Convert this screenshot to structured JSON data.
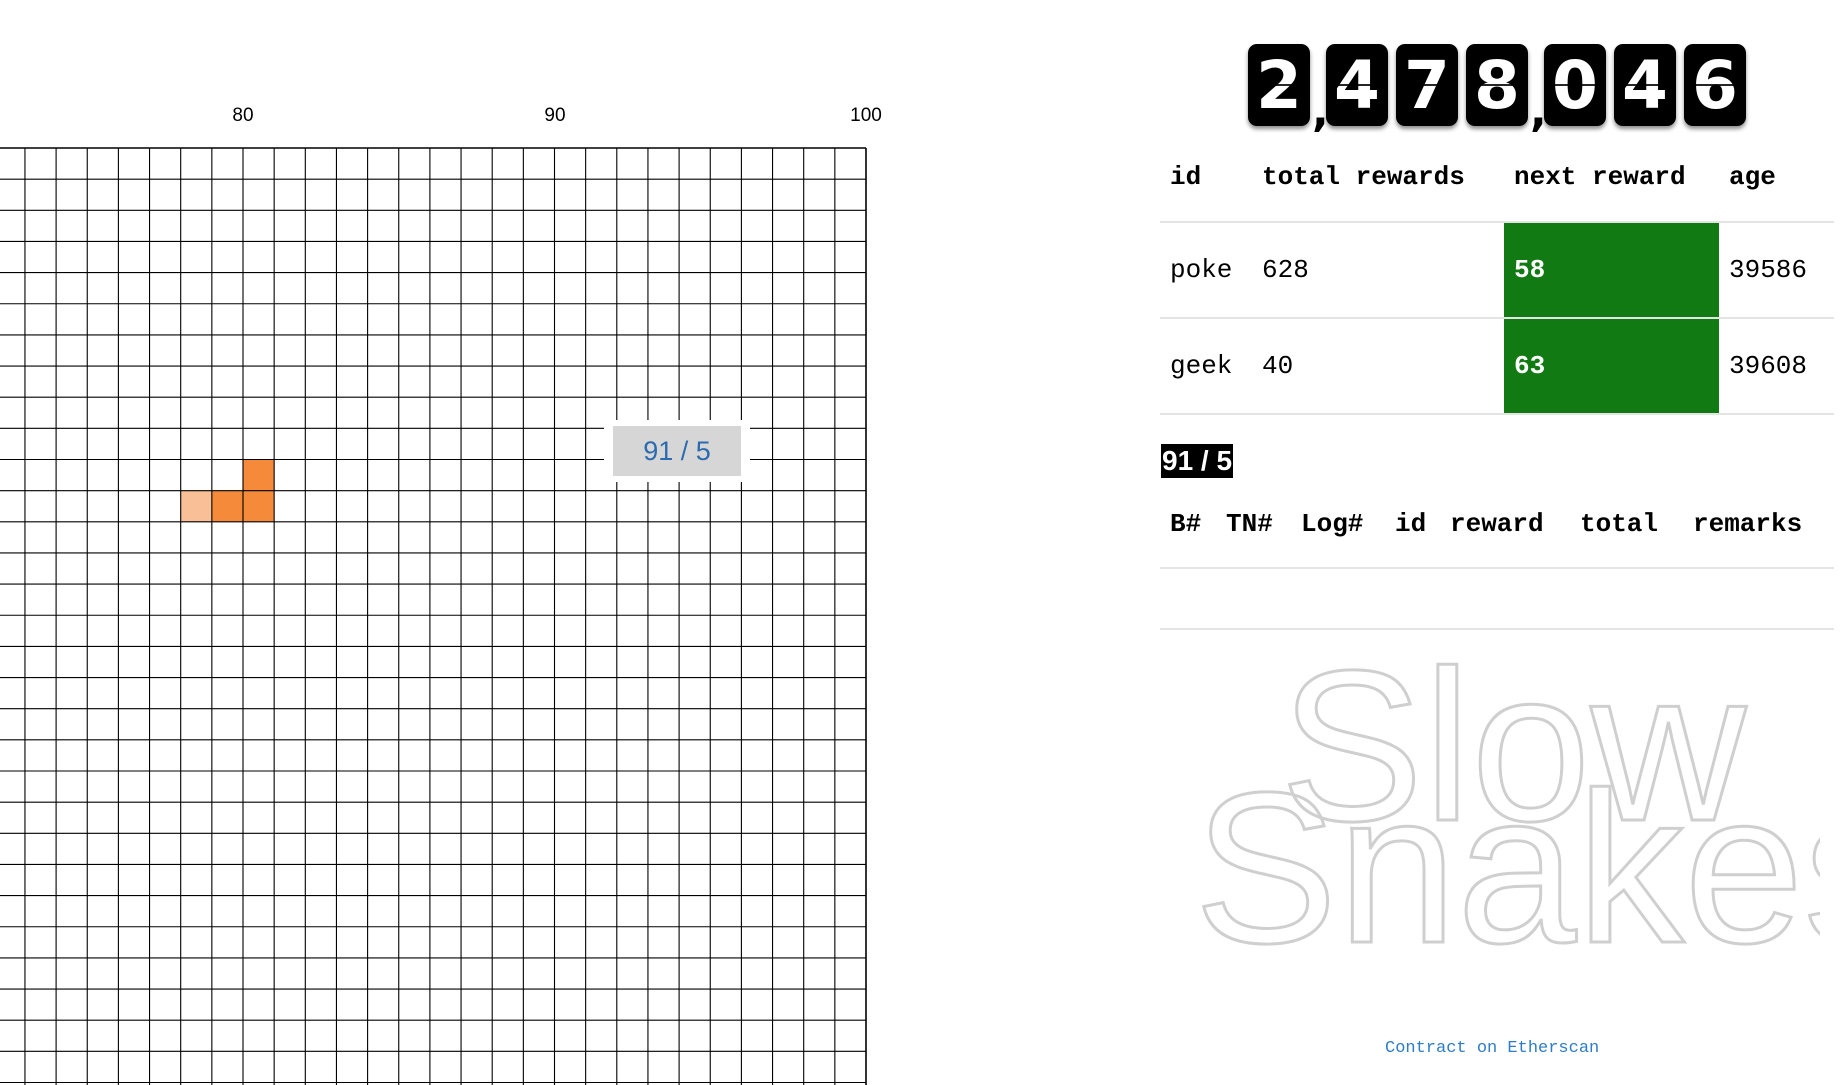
{
  "board": {
    "axis_labels": [
      "80",
      "90",
      "100"
    ],
    "tooltip": "91 / 5",
    "snake": {
      "head_color": "#f58a3a",
      "tail_color": "#f9bf96"
    },
    "grid_color": "#000000"
  },
  "counter": {
    "value": "2,478,046",
    "digits": [
      "2",
      "4",
      "7",
      "8",
      "0",
      "4",
      "6"
    ],
    "separator": ","
  },
  "players_table": {
    "headers": [
      "id",
      "total rewards",
      "next reward",
      "age"
    ],
    "rows": [
      {
        "id": "poke",
        "total_rewards": "628",
        "next_reward": "58",
        "age": "39586"
      },
      {
        "id": "geek",
        "total_rewards": "40",
        "next_reward": "63",
        "age": "39608"
      }
    ],
    "next_reward_color": "#117a13"
  },
  "selected_cell_badge": "91 / 5",
  "log_table": {
    "headers": [
      "B#",
      "TN#",
      "Log#",
      "id",
      "reward",
      "total",
      "remarks"
    ],
    "rows": []
  },
  "logo": {
    "line1": "Slow",
    "line2": "Snakes"
  },
  "footer": {
    "link_label": "Contract on Etherscan",
    "link_color": "#2f7cc8"
  }
}
